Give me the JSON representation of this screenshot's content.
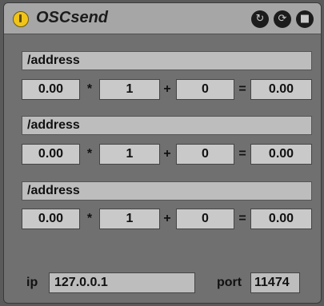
{
  "title": "OSCsend",
  "header_icons": [
    "loop-icon",
    "refresh-icon",
    "save-icon"
  ],
  "rows": [
    {
      "address": "/address",
      "value": "0.00",
      "multiplier": "1",
      "offset": "0",
      "result": "0.00"
    },
    {
      "address": "/address",
      "value": "0.00",
      "multiplier": "1",
      "offset": "0",
      "result": "0.00"
    },
    {
      "address": "/address",
      "value": "0.00",
      "multiplier": "1",
      "offset": "0",
      "result": "0.00"
    }
  ],
  "ops": {
    "multiply": "*",
    "add": "+",
    "equals": "="
  },
  "ip": {
    "label": "ip",
    "value": "127.0.0.1"
  },
  "port": {
    "label": "port",
    "value": "11474"
  }
}
